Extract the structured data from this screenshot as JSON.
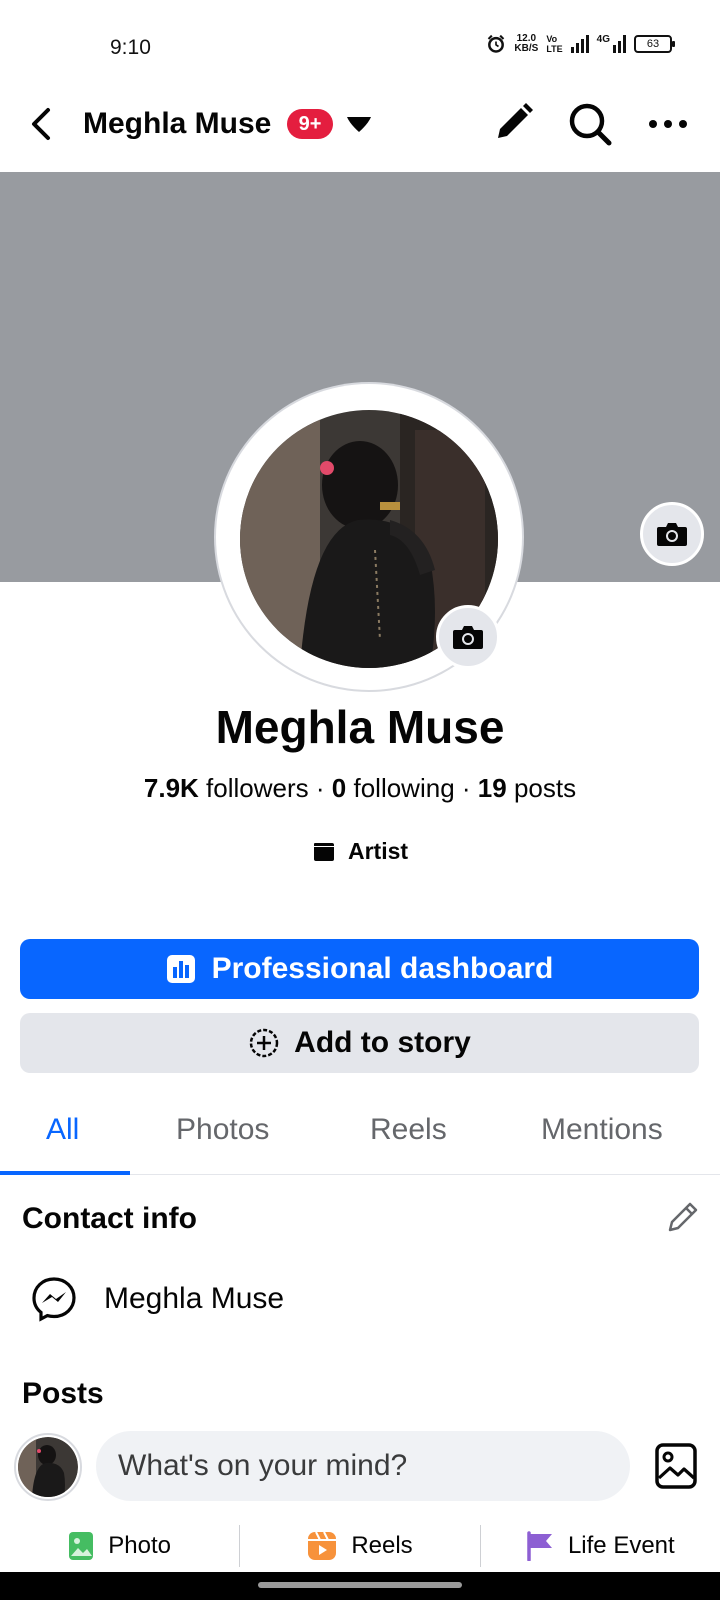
{
  "status_bar": {
    "time": "9:10",
    "net_speed_value": "12.0",
    "net_speed_unit": "KB/S",
    "volte_top": "Vo",
    "volte_bottom": "LTE",
    "network_type": "4G",
    "battery": "63"
  },
  "nav": {
    "title": "Meghla Muse",
    "badge": "9+",
    "icons": [
      "back-icon",
      "caret-down-icon",
      "edit-pencil-icon",
      "search-icon",
      "more-icon"
    ]
  },
  "profile": {
    "name": "Meghla Muse",
    "followers_count": "7.9K",
    "followers_label": "followers",
    "following_count": "0",
    "following_label": "following",
    "posts_count": "19",
    "posts_label": "posts",
    "separator": "·",
    "category": "Artist"
  },
  "buttons": {
    "dashboard": "Professional dashboard",
    "add_story": "Add to story"
  },
  "tabs": [
    {
      "label": "All",
      "active": true
    },
    {
      "label": "Photos",
      "active": false
    },
    {
      "label": "Reels",
      "active": false
    },
    {
      "label": "Mentions",
      "active": false
    }
  ],
  "contact": {
    "title": "Contact info",
    "messenger_name": "Meghla Muse"
  },
  "posts": {
    "title": "Posts",
    "composer_placeholder": "What's on your mind?"
  },
  "actions": {
    "photo": "Photo",
    "reels": "Reels",
    "life_event": "Life Event"
  },
  "colors": {
    "accent": "#0866ff",
    "badge": "#e41e3f",
    "cover": "#989ba0",
    "photo_icon": "#45bd62",
    "reels_icon": "#f7923b",
    "life_event_icon": "#8d5fd3"
  }
}
